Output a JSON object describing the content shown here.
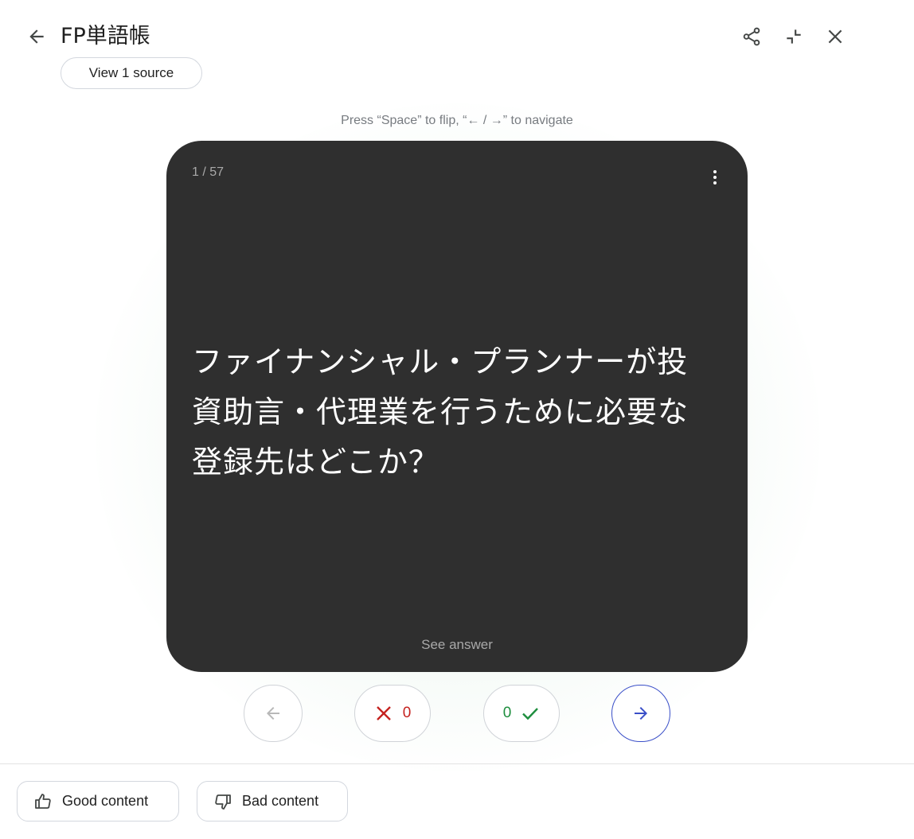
{
  "header": {
    "title": "FP単語帳",
    "back_icon": "arrow-left-icon",
    "share_icon": "share-icon",
    "collapse_icon": "collapse-icon",
    "close_icon": "close-icon"
  },
  "source_button": {
    "label": "View 1 source"
  },
  "hint": "Press “Space” to flip, “← / →” to navigate",
  "card": {
    "counter": "1 / 57",
    "question": "ファイナンシャル・プランナーが投資助言・代理業を行うために必要な登録先はどこか？",
    "see_answer": "See answer",
    "more_icon": "more-vert-icon",
    "background": "#2f2f2f"
  },
  "controls": {
    "wrong_count": "0",
    "right_count": "0",
    "wrong_color": "#c5221f",
    "right_color": "#1e8e3e",
    "next_accent": "#3a4fc8"
  },
  "feedback": {
    "good_label": "Good content",
    "bad_label": "Bad content"
  }
}
